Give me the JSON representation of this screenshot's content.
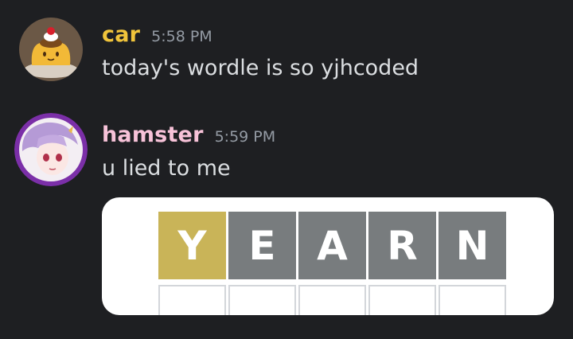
{
  "messages": [
    {
      "username": "car",
      "username_color": "#f0c43b",
      "timestamp": "5:58 PM",
      "text": "today's wordle is so yjhcoded",
      "avatar_icon": "pudding-avatar-icon"
    },
    {
      "username": "hamster",
      "username_color": "#f7c2d8",
      "timestamp": "5:59 PM",
      "text": "u lied to me",
      "avatar_icon": "anime-girl-avatar-icon",
      "attachment": {
        "type": "wordle-screenshot",
        "row1": [
          {
            "letter": "Y",
            "state": "present"
          },
          {
            "letter": "E",
            "state": "absent"
          },
          {
            "letter": "A",
            "state": "absent"
          },
          {
            "letter": "R",
            "state": "absent"
          },
          {
            "letter": "N",
            "state": "absent"
          }
        ],
        "colors": {
          "present": "#c9b458",
          "absent": "#787c7e",
          "empty_border": "#d3d6da"
        }
      }
    }
  ],
  "theme": {
    "background": "#1e1f22",
    "text": "#dbdee1",
    "timestamp": "#949ba4"
  }
}
